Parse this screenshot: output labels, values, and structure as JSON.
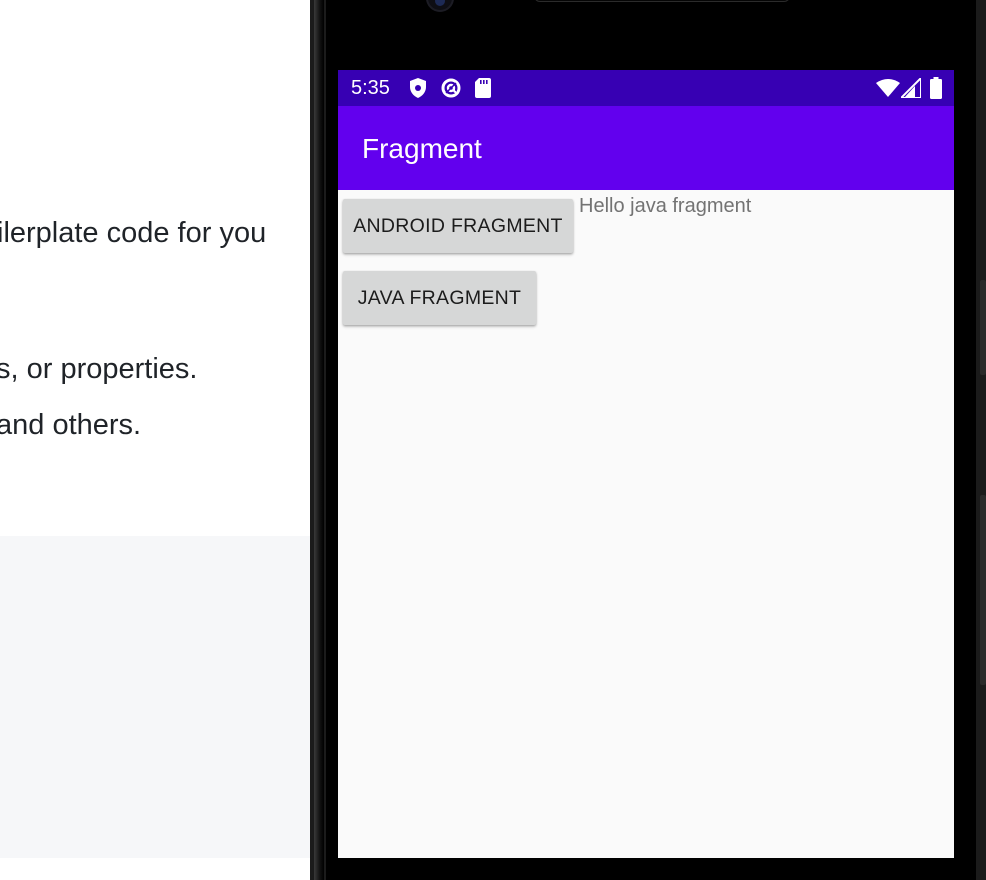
{
  "background_page": {
    "line1": "ilerplate code for you",
    "line2": "s, or properties.",
    "line3": "and others."
  },
  "status_bar": {
    "time": "5:35",
    "left_icons": [
      "shield-icon",
      "at-sign-icon",
      "sd-card-icon"
    ],
    "right_icons": [
      "wifi-icon",
      "cellular-signal-icon",
      "battery-icon"
    ],
    "color": "#3700b3"
  },
  "app_bar": {
    "title": "Fragment",
    "color": "#6200ee"
  },
  "content": {
    "android_fragment_button": "ANDROID FRAGMENT",
    "java_fragment_button": "JAVA FRAGMENT",
    "fragment_text": "Hello java fragment"
  }
}
